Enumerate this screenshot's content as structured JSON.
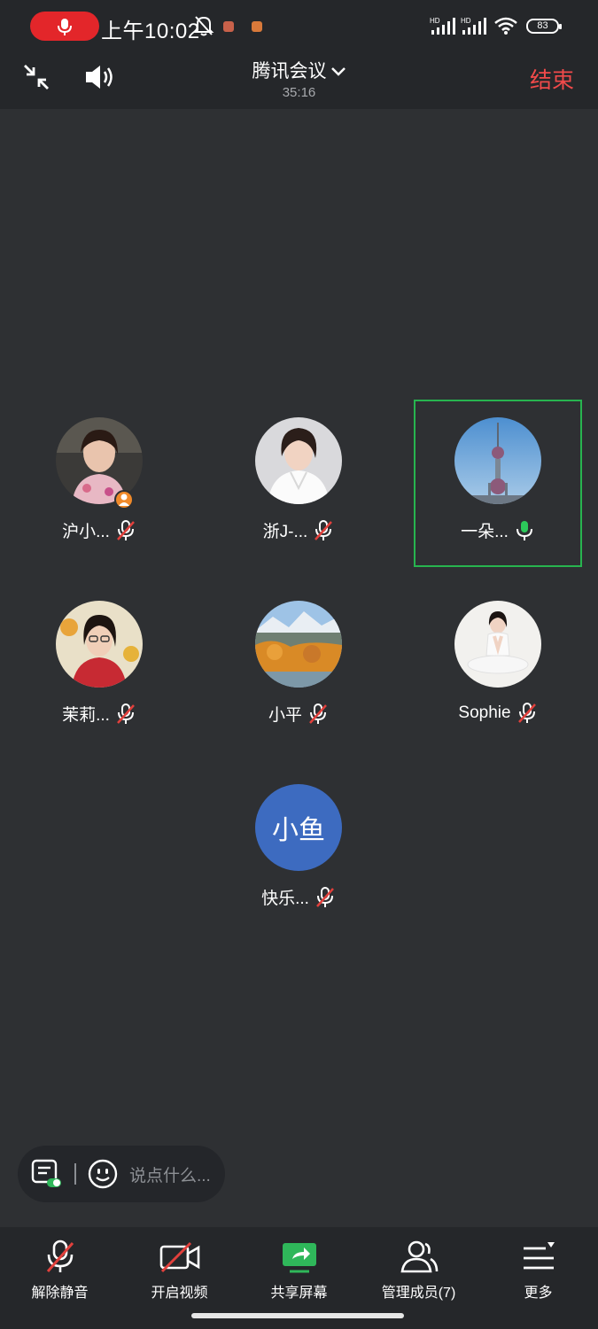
{
  "status_bar": {
    "time": "上午10:02",
    "battery": "83",
    "signal_labels": [
      "HD",
      "HD"
    ]
  },
  "header": {
    "title": "腾讯会议",
    "duration": "35:16",
    "end_label": "结束"
  },
  "participants": [
    {
      "name": "沪小...",
      "mic": "off",
      "avatar": "photo-woman-flowers",
      "host": true
    },
    {
      "name": "浙J-...",
      "mic": "off",
      "avatar": "photo-woman-white-suit",
      "host": false
    },
    {
      "name": "一朵...",
      "mic": "on",
      "avatar": "photo-tv-tower",
      "host": false,
      "speaking": true
    },
    {
      "name": "茉莉...",
      "mic": "off",
      "avatar": "photo-woman-glasses",
      "host": false
    },
    {
      "name": "小平",
      "mic": "off",
      "avatar": "photo-autumn-landscape",
      "host": false
    },
    {
      "name": "Sophie",
      "mic": "off",
      "avatar": "photo-yoga",
      "host": false
    },
    {
      "name": "快乐...",
      "mic": "off",
      "avatar": "text",
      "avatar_text": "小鱼",
      "host": false
    }
  ],
  "chat": {
    "placeholder": "说点什么..."
  },
  "toolbar": [
    {
      "label": "解除静音",
      "icon": "mic-muted-icon"
    },
    {
      "label": "开启视频",
      "icon": "camera-off-icon"
    },
    {
      "label": "共享屏幕",
      "icon": "share-screen-icon"
    },
    {
      "label": "管理成员(7)",
      "icon": "members-icon"
    },
    {
      "label": "更多",
      "icon": "more-menu-icon"
    }
  ],
  "colors": {
    "background": "#2e3033",
    "bar": "#25272a",
    "end": "#f04a4a",
    "active_speaker": "#27b44f",
    "share_icon": "#2fb75a",
    "mute_slash": "#e2403c"
  }
}
